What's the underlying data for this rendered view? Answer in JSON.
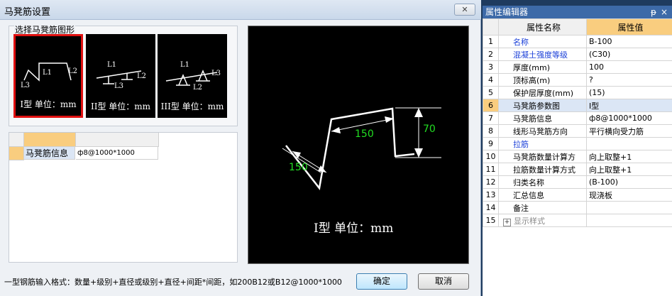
{
  "dialog": {
    "title": "马凳筋设置",
    "close_label": "✕",
    "group_label": "选择马凳筋图形",
    "shapes": [
      {
        "caption": "I型 单位：mm",
        "l1": "L1",
        "l2": "L2",
        "l3": "L3"
      },
      {
        "caption": "II型 单位：mm",
        "l1": "L1",
        "l2": "L2",
        "l3": "L3"
      },
      {
        "caption": "III型 单位：mm",
        "l1": "L1",
        "l2": "L2",
        "l3": "L3"
      }
    ],
    "grid": {
      "row_label": "马凳筋信息",
      "row_value": "ф8@1000*1000"
    },
    "preview": {
      "dim_top": "150",
      "dim_bottom": "150",
      "dim_height": "70",
      "caption": "I型 单位：mm"
    },
    "hint": "一型钢筋输入格式：数量+级别+直径或级别+直径+间距*间距，如200B12或B12@1000*1000",
    "ok_label": "确定",
    "cancel_label": "取消"
  },
  "property_editor": {
    "title": "属性编辑器",
    "pin": "ᵽ",
    "close": "×",
    "col_name": "属性名称",
    "col_value": "属性值",
    "rows": [
      {
        "n": "1",
        "name": "名称",
        "value": "B-100"
      },
      {
        "n": "2",
        "name": "混凝土强度等级",
        "value": "(C30)"
      },
      {
        "n": "3",
        "name": "厚度(mm)",
        "value": "100"
      },
      {
        "n": "4",
        "name": "顶标高(m)",
        "value": "?"
      },
      {
        "n": "5",
        "name": "保护层厚度(mm)",
        "value": "(15)"
      },
      {
        "n": "6",
        "name": "马凳筋参数图",
        "value": "I型"
      },
      {
        "n": "7",
        "name": "马凳筋信息",
        "value": "ф8@1000*1000"
      },
      {
        "n": "8",
        "name": "线形马凳筋方向",
        "value": "平行横向受力筋"
      },
      {
        "n": "9",
        "name": "拉筋",
        "value": ""
      },
      {
        "n": "10",
        "name": "马凳筋数量计算方",
        "value": "向上取整+1"
      },
      {
        "n": "11",
        "name": "拉筋数量计算方式",
        "value": "向上取整+1"
      },
      {
        "n": "12",
        "name": "归类名称",
        "value": "(B-100)"
      },
      {
        "n": "13",
        "name": "汇总信息",
        "value": "现浇板"
      },
      {
        "n": "14",
        "name": "备注",
        "value": ""
      },
      {
        "n": "15",
        "name": "显示样式",
        "value": ""
      }
    ],
    "expand_symbol": "+"
  }
}
